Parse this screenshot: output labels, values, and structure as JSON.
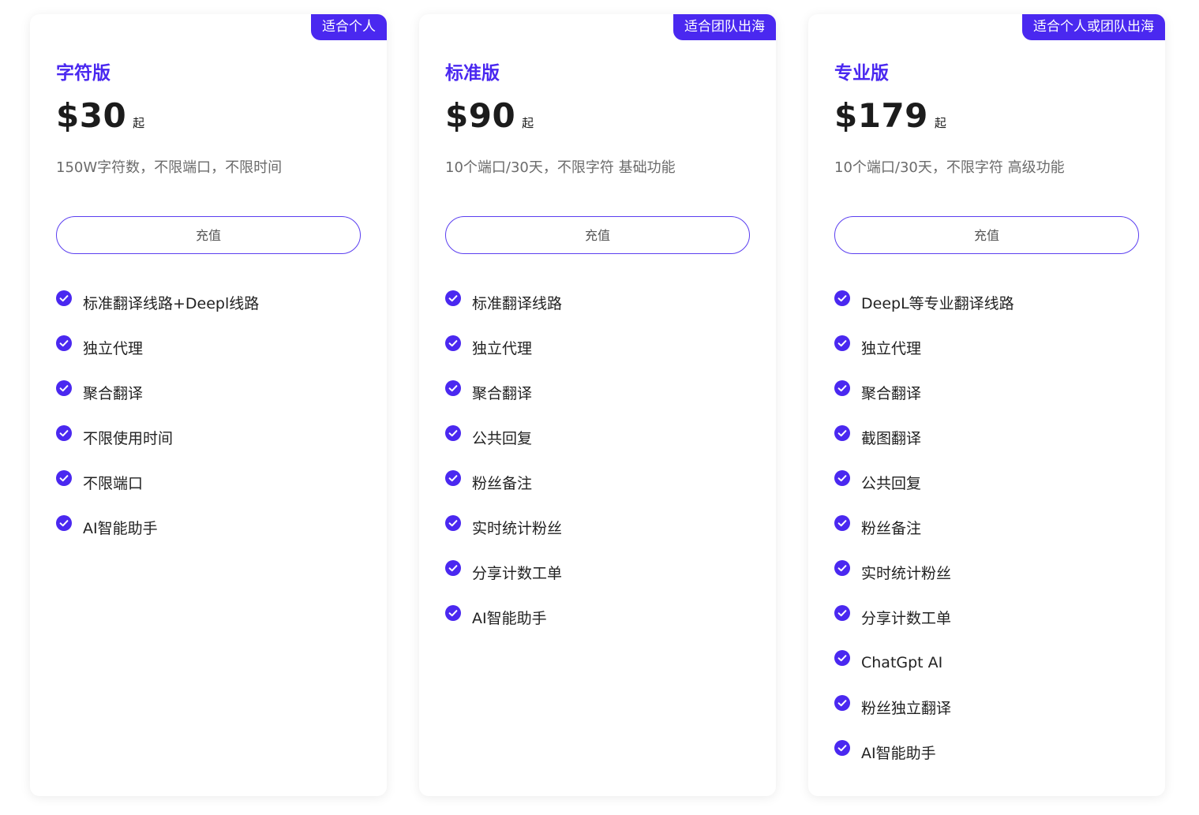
{
  "accent_color": "#4a28f0",
  "plans": [
    {
      "badge": "适合个人",
      "name": "字符版",
      "price": "$30",
      "price_suffix": "起",
      "description": "150W字符数，不限端口，不限时间",
      "button_label": "充值",
      "features": [
        "标准翻译线路+Deepl线路",
        "独立代理",
        "聚合翻译",
        "不限使用时间",
        "不限端口",
        "AI智能助手"
      ]
    },
    {
      "badge": "适合团队出海",
      "name": "标准版",
      "price": "$90",
      "price_suffix": "起",
      "description": "10个端口/30天，不限字符 基础功能",
      "button_label": "充值",
      "features": [
        "标准翻译线路",
        "独立代理",
        "聚合翻译",
        "公共回复",
        "粉丝备注",
        "实时统计粉丝",
        "分享计数工单",
        "AI智能助手"
      ]
    },
    {
      "badge": "适合个人或团队出海",
      "name": "专业版",
      "price": "$179",
      "price_suffix": "起",
      "description": "10个端口/30天，不限字符 高级功能",
      "button_label": "充值",
      "features": [
        "DeepL等专业翻译线路",
        "独立代理",
        "聚合翻译",
        "截图翻译",
        "公共回复",
        "粉丝备注",
        "实时统计粉丝",
        "分享计数工单",
        "ChatGpt AI",
        "粉丝独立翻译",
        "AI智能助手"
      ]
    }
  ]
}
